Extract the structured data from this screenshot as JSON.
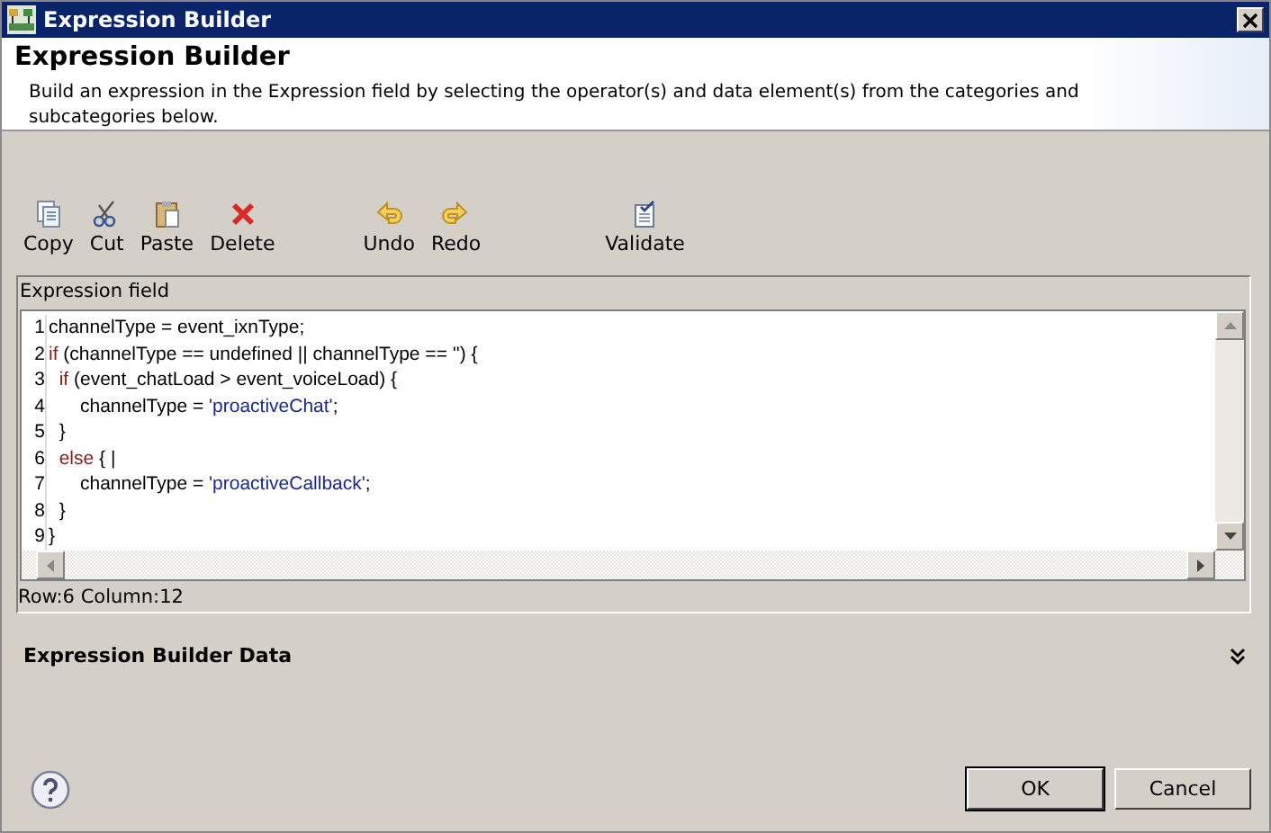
{
  "window": {
    "title": "Expression Builder"
  },
  "header": {
    "title": "Expression Builder",
    "description": "Build an expression in the Expression field by selecting the operator(s) and data element(s) from the categories and subcategories below."
  },
  "toolbar": [
    {
      "kind": "copy",
      "label": "Copy"
    },
    {
      "kind": "cut",
      "label": "Cut"
    },
    {
      "kind": "paste",
      "label": "Paste"
    },
    {
      "kind": "delete",
      "label": "Delete"
    },
    {
      "kind": "gap"
    },
    {
      "kind": "undo",
      "label": "Undo"
    },
    {
      "kind": "redo",
      "label": "Redo"
    },
    {
      "kind": "gap"
    },
    {
      "kind": "validate",
      "label": "Validate"
    }
  ],
  "expression_field": {
    "label": "Expression field",
    "lines": [
      {
        "number": "1",
        "tokens": [
          {
            "kind": "plain",
            "text": "channelType = event_ixnType;"
          }
        ]
      },
      {
        "number": "2",
        "tokens": [
          {
            "kind": "keyword",
            "text": "if"
          },
          {
            "kind": "plain",
            "text": " (channelType == undefined || channelType == '') {"
          }
        ]
      },
      {
        "number": "3",
        "tokens": [
          {
            "kind": "keyword",
            "text": "  if"
          },
          {
            "kind": "plain",
            "text": " (event_chatLoad > event_voiceLoad) {"
          }
        ]
      },
      {
        "number": "4",
        "tokens": [
          {
            "kind": "plain",
            "text": "      channelType = "
          },
          {
            "kind": "string",
            "text": "'proactiveChat'"
          },
          {
            "kind": "plain",
            "text": ";"
          }
        ]
      },
      {
        "number": "5",
        "tokens": [
          {
            "kind": "plain",
            "text": "  }"
          }
        ]
      },
      {
        "number": "6",
        "tokens": [
          {
            "kind": "keyword",
            "text": "  else"
          },
          {
            "kind": "plain",
            "text": " { |"
          }
        ]
      },
      {
        "number": "7",
        "tokens": [
          {
            "kind": "plain",
            "text": "      channelType = "
          },
          {
            "kind": "string",
            "text": "'proactiveCallback'"
          },
          {
            "kind": "plain",
            "text": ";"
          }
        ]
      },
      {
        "number": "8",
        "tokens": [
          {
            "kind": "plain",
            "text": "  }"
          }
        ]
      },
      {
        "number": "9",
        "tokens": [
          {
            "kind": "plain",
            "text": "}"
          }
        ]
      }
    ],
    "status": "Row:6 Column:12"
  },
  "data_section": {
    "title": "Expression Builder Data",
    "expanded": false
  },
  "buttons": [
    {
      "label": "OK",
      "default": true
    },
    {
      "label": "Cancel",
      "default": false
    }
  ]
}
